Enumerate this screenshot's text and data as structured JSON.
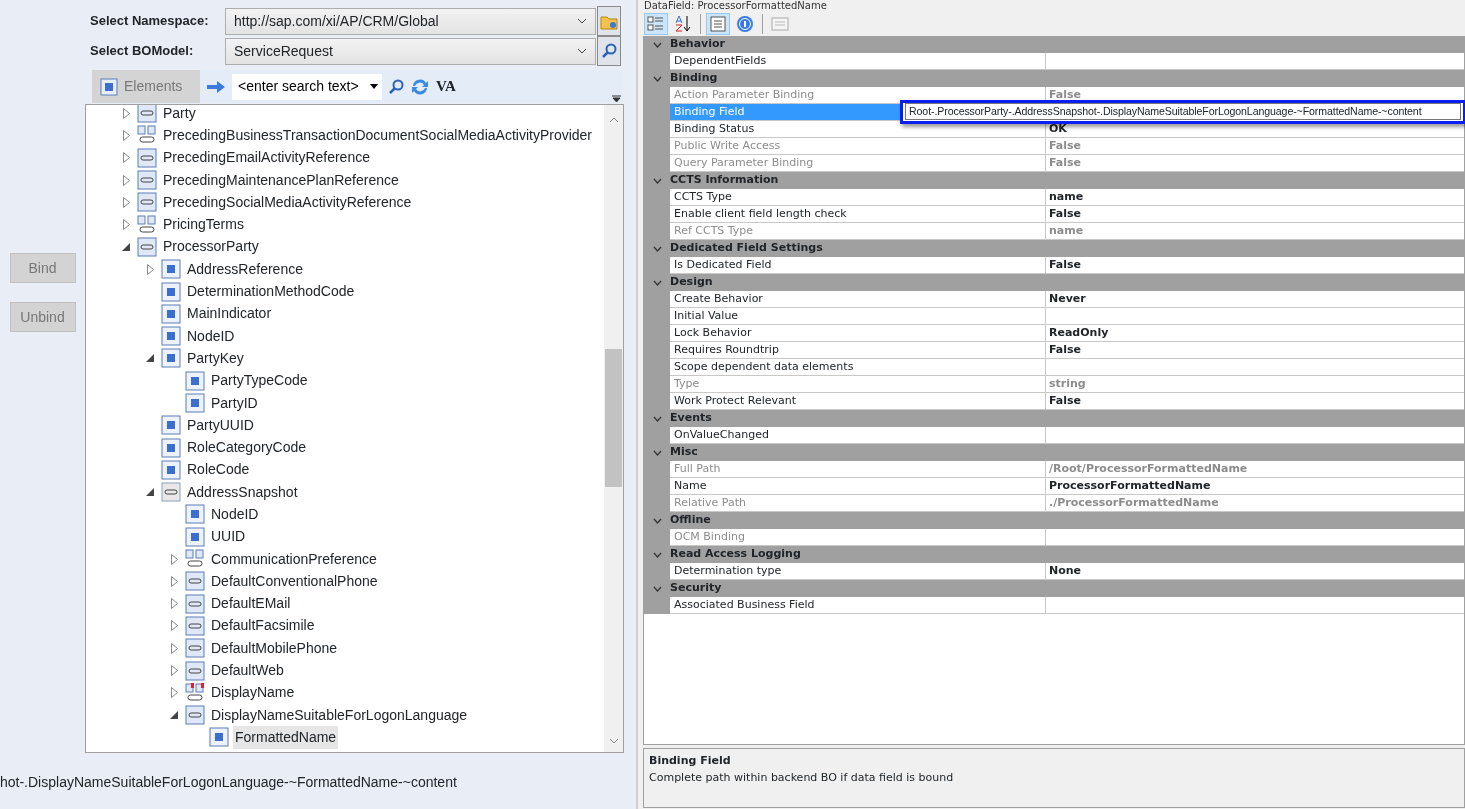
{
  "selector": {
    "namespace_label": "Select Namespace:",
    "namespace_value": "http://sap.com/xi/AP/CRM/Global",
    "bomodel_label": "Select BOModel:",
    "bomodel_value": "ServiceRequest"
  },
  "toolbar": {
    "elements_label": "Elements",
    "search_placeholder": "<enter search text>",
    "va_label": "VA"
  },
  "buttons": [
    {
      "label": "Bind"
    },
    {
      "label": "Unbind"
    }
  ],
  "tree": [
    {
      "label": "Party",
      "kind": "association",
      "expanded": false
    },
    {
      "label": "PrecedingBusinessTransactionDocumentSocialMediaActivityProvider",
      "kind": "group",
      "expanded": false
    },
    {
      "label": "PrecedingEmailActivityReference",
      "kind": "association",
      "expanded": false
    },
    {
      "label": "PrecedingMaintenancePlanReference",
      "kind": "association",
      "expanded": false
    },
    {
      "label": "PrecedingSocialMediaActivityReference",
      "kind": "association",
      "expanded": false
    },
    {
      "label": "PricingTerms",
      "kind": "group",
      "expanded": false
    },
    {
      "label": "ProcessorParty",
      "kind": "association",
      "expanded": true,
      "children": [
        {
          "label": "AddressReference",
          "kind": "element",
          "expanded": false
        },
        {
          "label": "DeterminationMethodCode",
          "kind": "element"
        },
        {
          "label": "MainIndicator",
          "kind": "element"
        },
        {
          "label": "NodeID",
          "kind": "element"
        },
        {
          "label": "PartyKey",
          "kind": "element",
          "expanded": true,
          "children": [
            {
              "label": "PartyTypeCode",
              "kind": "element"
            },
            {
              "label": "PartyID",
              "kind": "element"
            }
          ]
        },
        {
          "label": "PartyUUID",
          "kind": "element"
        },
        {
          "label": "RoleCategoryCode",
          "kind": "element"
        },
        {
          "label": "RoleCode",
          "kind": "element"
        },
        {
          "label": "AddressSnapshot",
          "kind": "association-grey",
          "expanded": true,
          "children": [
            {
              "label": "NodeID",
              "kind": "element"
            },
            {
              "label": "UUID",
              "kind": "element"
            },
            {
              "label": "CommunicationPreference",
              "kind": "group",
              "expanded": false
            },
            {
              "label": "DefaultConventionalPhone",
              "kind": "association",
              "expanded": false
            },
            {
              "label": "DefaultEMail",
              "kind": "association",
              "expanded": false
            },
            {
              "label": "DefaultFacsimile",
              "kind": "association",
              "expanded": false
            },
            {
              "label": "DefaultMobilePhone",
              "kind": "association",
              "expanded": false
            },
            {
              "label": "DefaultWeb",
              "kind": "association",
              "expanded": false
            },
            {
              "label": "DisplayName",
              "kind": "group-flagged",
              "expanded": false
            },
            {
              "label": "DisplayNameSuitableForLogonLanguage",
              "kind": "association",
              "expanded": true,
              "children": [
                {
                  "label": "FormattedName",
                  "kind": "element",
                  "selected": true
                }
              ]
            }
          ]
        }
      ]
    }
  ],
  "binding_path": "hot-.DisplayNameSuitableForLogonLanguage-~FormattedName-~content",
  "properties": {
    "title": "DataField: ProcessorFormattedName",
    "toolbar": [
      {
        "kind": "categorized",
        "selected": true
      },
      {
        "kind": "alphabetical",
        "selected": false
      },
      {
        "kind": "pages",
        "selected": true
      },
      {
        "kind": "help",
        "selected": false
      },
      {
        "kind": "disabled-pages",
        "selected": false
      }
    ],
    "categories": [
      {
        "name": "Behavior",
        "expanded": true,
        "rows": [
          {
            "label": "DependentFields",
            "disabled": false,
            "selected": false
          }
        ]
      },
      {
        "name": "Binding",
        "expanded": true,
        "rows": [
          {
            "label": "Action Parameter Binding",
            "value": "False",
            "disabled": true,
            "selected": false
          },
          {
            "label": "Binding Field",
            "disabled": false,
            "selected": true
          },
          {
            "label": "Binding Status",
            "value": "OK",
            "disabled": false,
            "selected": false
          },
          {
            "label": "Public Write Access",
            "value": "False",
            "disabled": true,
            "selected": false
          },
          {
            "label": "Query Parameter Binding",
            "value": "False",
            "disabled": true,
            "selected": false
          }
        ]
      },
      {
        "name": "CCTS Information",
        "expanded": true,
        "rows": [
          {
            "label": "CCTS Type",
            "value": "name",
            "disabled": false,
            "selected": false
          },
          {
            "label": "Enable client field length check",
            "value": "False",
            "disabled": false,
            "selected": false
          },
          {
            "label": "Ref CCTS Type",
            "value": "name",
            "disabled": true,
            "selected": false
          }
        ]
      },
      {
        "name": "Dedicated Field Settings",
        "expanded": true,
        "rows": [
          {
            "label": "Is Dedicated Field",
            "value": "False",
            "disabled": false,
            "selected": false
          }
        ]
      },
      {
        "name": "Design",
        "expanded": true,
        "rows": [
          {
            "label": "Create Behavior",
            "value": "Never",
            "disabled": false,
            "selected": false
          },
          {
            "label": "Initial Value",
            "disabled": false,
            "selected": false
          },
          {
            "label": "Lock Behavior",
            "value": "ReadOnly",
            "disabled": false,
            "selected": false
          },
          {
            "label": "Requires Roundtrip",
            "value": "False",
            "disabled": false,
            "selected": false
          },
          {
            "label": "Scope dependent data elements",
            "disabled": false,
            "selected": false
          },
          {
            "label": "Type",
            "value": "string",
            "disabled": true,
            "selected": false
          },
          {
            "label": "Work Protect Relevant",
            "value": "False",
            "disabled": false,
            "selected": false
          }
        ]
      },
      {
        "name": "Events",
        "expanded": true,
        "rows": [
          {
            "label": "OnValueChanged",
            "disabled": false,
            "selected": false
          }
        ]
      },
      {
        "name": "Misc",
        "expanded": true,
        "rows": [
          {
            "label": "Full Path",
            "value": "/Root/ProcessorFormattedName",
            "disabled": true,
            "selected": false
          },
          {
            "label": "Name",
            "value": "ProcessorFormattedName",
            "disabled": false,
            "selected": false
          },
          {
            "label": "Relative Path",
            "value": "./ProcessorFormattedName",
            "disabled": true,
            "selected": false
          }
        ]
      },
      {
        "name": "Offline",
        "expanded": true,
        "rows": [
          {
            "label": "OCM Binding",
            "disabled": true,
            "selected": false
          }
        ]
      },
      {
        "name": "Read Access Logging",
        "expanded": true,
        "rows": [
          {
            "label": "Determination type",
            "value": "None",
            "disabled": false,
            "selected": false
          }
        ]
      },
      {
        "name": "Security",
        "expanded": true,
        "rows": [
          {
            "label": "Associated Business Field",
            "disabled": false,
            "selected": false
          }
        ]
      }
    ],
    "tooltip": "Root-.ProcessorParty-.AddressSnapshot-.DisplayNameSuitableForLogonLanguage-~FormattedName-~content",
    "help": {
      "title": "Binding Field",
      "description": "Complete path within backend BO if data field is bound"
    }
  }
}
